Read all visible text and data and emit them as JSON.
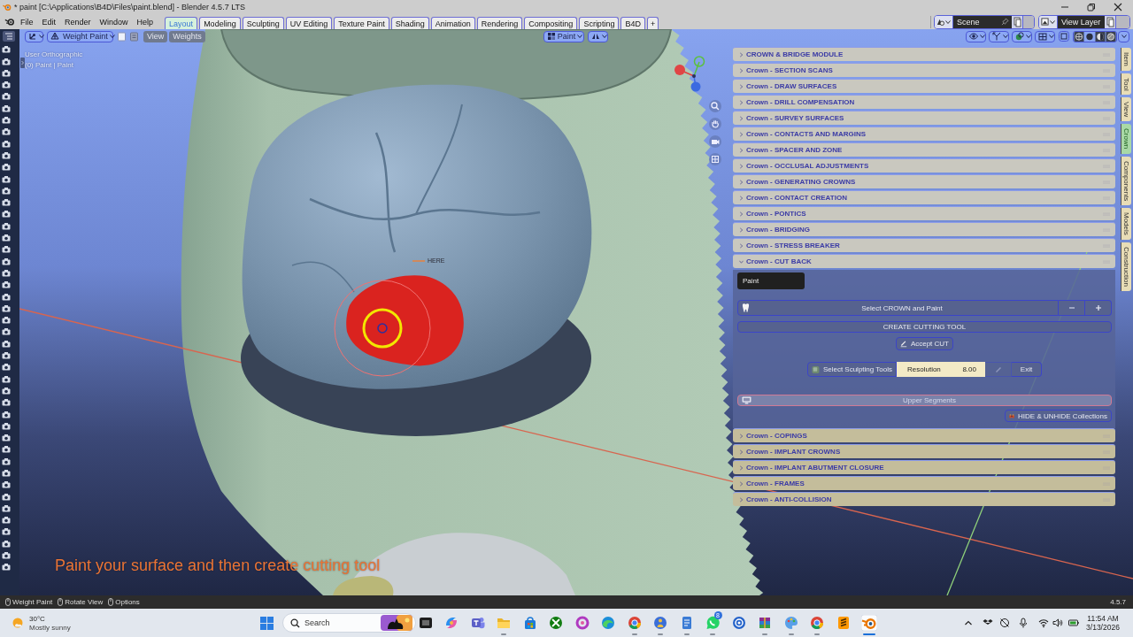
{
  "window": {
    "title": "* paint [C:\\Applications\\B4D\\Files\\paint.blend] - Blender 4.5.7 LTS"
  },
  "menu": [
    "File",
    "Edit",
    "Render",
    "Window",
    "Help"
  ],
  "workspaces": [
    {
      "label": "Layout",
      "selected": true
    },
    {
      "label": "Modeling",
      "selected": false
    },
    {
      "label": "Sculpting",
      "selected": false
    },
    {
      "label": "UV Editing",
      "selected": false
    },
    {
      "label": "Texture Paint",
      "selected": false
    },
    {
      "label": "Shading",
      "selected": false
    },
    {
      "label": "Animation",
      "selected": false
    },
    {
      "label": "Rendering",
      "selected": false
    },
    {
      "label": "Compositing",
      "selected": false
    },
    {
      "label": "Scripting",
      "selected": false
    },
    {
      "label": "B4D",
      "selected": false
    }
  ],
  "add_workspace": "+",
  "scene": {
    "name": "Scene"
  },
  "view_layer": {
    "name": "View Layer"
  },
  "viewport_header": {
    "mode": "Weight Paint",
    "menus": [
      "View",
      "Weights"
    ],
    "brush": "Paint"
  },
  "viewport": {
    "view_name": "User Orthographic",
    "object_info": "(0) Paint | Paint",
    "marker_label": "HERE",
    "caption": "Paint your surface and then create cutting tool"
  },
  "sidebar": {
    "panels": [
      {
        "title": "CROWN & BRIDGE MODULE",
        "expanded": false
      },
      {
        "title": "Crown - SECTION SCANS",
        "expanded": false
      },
      {
        "title": "Crown - DRAW SURFACES",
        "expanded": false
      },
      {
        "title": "Crown - DRILL COMPENSATION",
        "expanded": false
      },
      {
        "title": "Crown - SURVEY SURFACES",
        "expanded": false
      },
      {
        "title": "Crown - CONTACTS AND MARGINS",
        "expanded": false
      },
      {
        "title": "Crown - SPACER AND ZONE",
        "expanded": false
      },
      {
        "title": "Crown - OCCLUSAL ADJUSTMENTS",
        "expanded": false
      },
      {
        "title": "Crown - GENERATING CROWNS",
        "expanded": false
      },
      {
        "title": "Crown - CONTACT CREATION",
        "expanded": false
      },
      {
        "title": "Crown - PONTICS",
        "expanded": false
      },
      {
        "title": "Crown - BRIDGING",
        "expanded": false
      },
      {
        "title": "Crown - STRESS BREAKER",
        "expanded": false
      },
      {
        "title": "Crown - CUT BACK",
        "expanded": true
      },
      {
        "title": "Crown - COPINGS",
        "expanded": false
      },
      {
        "title": "Crown - IMPLANT CROWNS",
        "expanded": false
      },
      {
        "title": "Crown - IMPLANT ABUTMENT CLOSURE",
        "expanded": false
      },
      {
        "title": "Crown - FRAMES",
        "expanded": false
      },
      {
        "title": "Crown - ANTI-COLLISION",
        "expanded": false
      }
    ],
    "cut_back": {
      "object_field": "Paint",
      "select_button": "Select CROWN and Paint",
      "create_button": "CREATE CUTTING TOOL",
      "accept_button": "Accept CUT",
      "sculpt_button": "Select Sculpting Tools",
      "resolution": {
        "label": "Resolution",
        "value": "8.00"
      },
      "edit_button": {
        "disabled": true
      },
      "exit_button": "Exit",
      "segments_button": "Upper Segments",
      "collections_button": "HIDE & UNHIDE Collections"
    },
    "tabs": [
      {
        "label": "Item",
        "selected": false
      },
      {
        "label": "Tool",
        "selected": false
      },
      {
        "label": "View",
        "selected": false
      },
      {
        "label": "Crown",
        "selected": true
      },
      {
        "label": "Components",
        "selected": false
      },
      {
        "label": "Models",
        "selected": false
      },
      {
        "label": "Construction",
        "selected": false
      }
    ]
  },
  "status_bar": {
    "items": [
      "Weight Paint",
      "Rotate View",
      "Options"
    ],
    "version": "4.5.7"
  },
  "taskbar": {
    "weather": {
      "temperature": "30°C",
      "condition": "Mostly sunny"
    },
    "search": {
      "label": "Search"
    },
    "apps": [
      {
        "kind": "taskview",
        "running": false,
        "selected": false
      },
      {
        "kind": "copilot",
        "running": false,
        "selected": false
      },
      {
        "kind": "people",
        "running": false,
        "selected": false
      },
      {
        "kind": "folder",
        "running": true,
        "selected": false
      },
      {
        "kind": "store",
        "running": false,
        "selected": false
      },
      {
        "kind": "xbox",
        "running": false,
        "selected": false
      },
      {
        "kind": "ring",
        "running": false,
        "selected": false
      },
      {
        "kind": "edge",
        "running": false,
        "selected": false
      },
      {
        "kind": "chrome",
        "running": true,
        "selected": false
      },
      {
        "kind": "figure",
        "running": true,
        "selected": false
      },
      {
        "kind": "notepad",
        "running": true,
        "selected": false
      },
      {
        "kind": "chat",
        "running": true,
        "selected": false,
        "badge": "8"
      },
      {
        "kind": "disc",
        "running": false,
        "selected": false
      },
      {
        "kind": "archive",
        "running": true,
        "selected": false
      },
      {
        "kind": "palette",
        "running": true,
        "selected": false
      },
      {
        "kind": "chrome",
        "running": true,
        "selected": false
      },
      {
        "kind": "editor",
        "running": false,
        "selected": false
      },
      {
        "kind": "blender",
        "running": true,
        "selected": true
      }
    ],
    "clock": {
      "time": "11:54 AM",
      "date": "3/13/2026"
    }
  }
}
